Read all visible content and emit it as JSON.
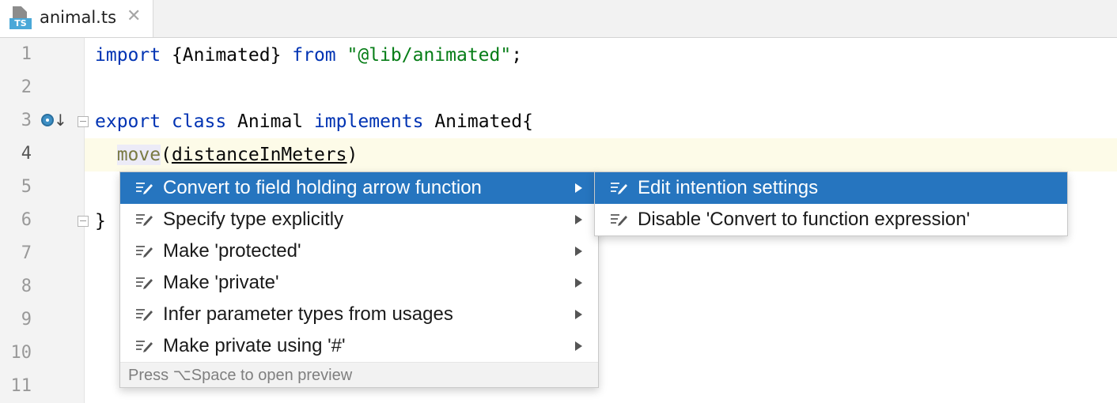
{
  "tab": {
    "icon_badge": "TS",
    "title": "animal.ts",
    "close_glyph": "✕"
  },
  "gutter": {
    "line_numbers": [
      "1",
      "2",
      "3",
      "4",
      "5",
      "6",
      "7",
      "8",
      "9",
      "10",
      "11"
    ],
    "current_line": "4",
    "icons": [
      "implemented-method-icon",
      "fold-marker-icon"
    ]
  },
  "code": {
    "line1": {
      "kw1": "import",
      "mid": " {Animated} ",
      "kw2": "from",
      "sp": " ",
      "str": "\"@lib/animated\"",
      "end": ";"
    },
    "line3": {
      "kw1": "export",
      "sp1": " ",
      "kw2": "class",
      "mid": " Animal ",
      "kw3": "implements",
      "end": " Animated{"
    },
    "line4": {
      "indent": "  ",
      "fn": "move",
      "open": "(",
      "param": "distanceInMeters",
      "close": ")"
    },
    "line6": {
      "text": "}"
    }
  },
  "intention_menu": {
    "items": [
      {
        "label": "Convert to field holding arrow function",
        "selected": true
      },
      {
        "label": "Specify type explicitly",
        "selected": false
      },
      {
        "label": "Make 'protected'",
        "selected": false
      },
      {
        "label": "Make 'private'",
        "selected": false
      },
      {
        "label": "Infer parameter types from usages",
        "selected": false
      },
      {
        "label": "Make private using '#'",
        "selected": false
      }
    ],
    "footer": "Press ⌥Space to open preview"
  },
  "submenu": {
    "items": [
      {
        "label": "Edit intention settings",
        "selected": true
      },
      {
        "label": "Disable 'Convert to function expression'",
        "selected": false
      }
    ]
  },
  "colors": {
    "selection": "#2675bf",
    "keyword": "#0033b3",
    "string": "#067d17",
    "current_line": "#fdfbe8"
  }
}
